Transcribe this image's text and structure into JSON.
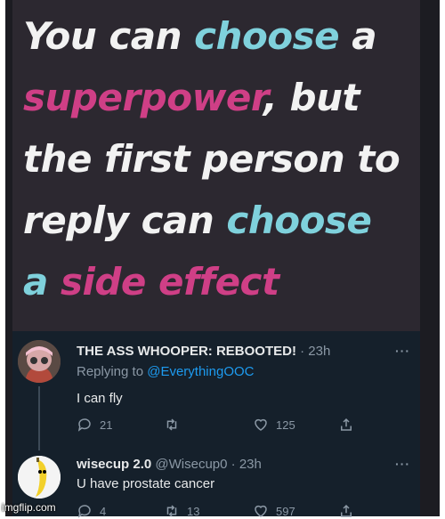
{
  "meme": {
    "line1_a": "You can ",
    "line1_b": "choose",
    "line1_c": " a",
    "line2_a": "superpower",
    "line2_b": ", but",
    "line3": "the first person to",
    "line4_a": "reply can ",
    "line4_b": "choose",
    "line5_a": "a",
    "line5_b": " side effect",
    "colors": {
      "cyan": "#7fd1dc",
      "pink": "#cf3f86"
    }
  },
  "tweet1": {
    "display_name": "THE ASS WHOOPER: REBOOTED!",
    "time": "· 23h",
    "replying_prefix": "Replying to ",
    "replying_handle": "@EverythingOOC",
    "text": "I can fly",
    "reply_count": "21",
    "retweet_count": "",
    "like_count": "125",
    "more": "···"
  },
  "tweet2": {
    "display_name": "wisecup 2.0",
    "handle": "@Wisecup0",
    "time": "· 23h",
    "text": "U have prostate cancer",
    "reply_count": "4",
    "retweet_count": "13",
    "like_count": "597",
    "more": "···"
  },
  "watermark": "imgflip.com",
  "icons": [
    "reply-icon",
    "retweet-icon",
    "like-icon",
    "share-icon",
    "more-icon"
  ],
  "theme": {
    "thread_bg": "#15202b",
    "link": "#1d9bf0",
    "muted": "#8b98a5"
  }
}
